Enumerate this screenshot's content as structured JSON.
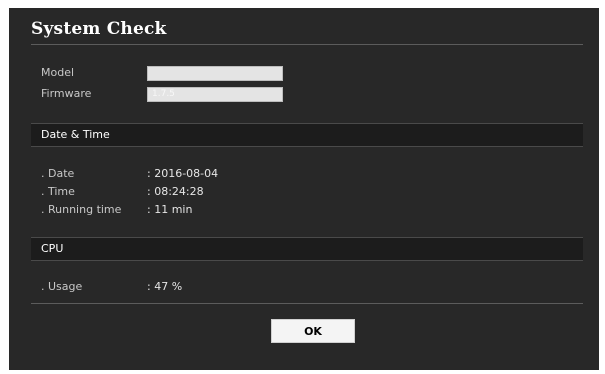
{
  "dialog": {
    "title": "System Check"
  },
  "info": {
    "model_label": "Model",
    "model_value": "",
    "firmware_label": "Firmware",
    "firmware_value": "1.7.5"
  },
  "date_time": {
    "heading": "Date & Time",
    "rows": [
      {
        "label": ". Date",
        "value": ": 2016-08-04"
      },
      {
        "label": ". Time",
        "value": ": 08:24:28"
      },
      {
        "label": ". Running time",
        "value": ": 11 min"
      }
    ]
  },
  "cpu": {
    "heading": "CPU",
    "rows": [
      {
        "label": ". Usage",
        "value": ": 47 %"
      }
    ]
  },
  "actions": {
    "ok_label": "OK"
  }
}
